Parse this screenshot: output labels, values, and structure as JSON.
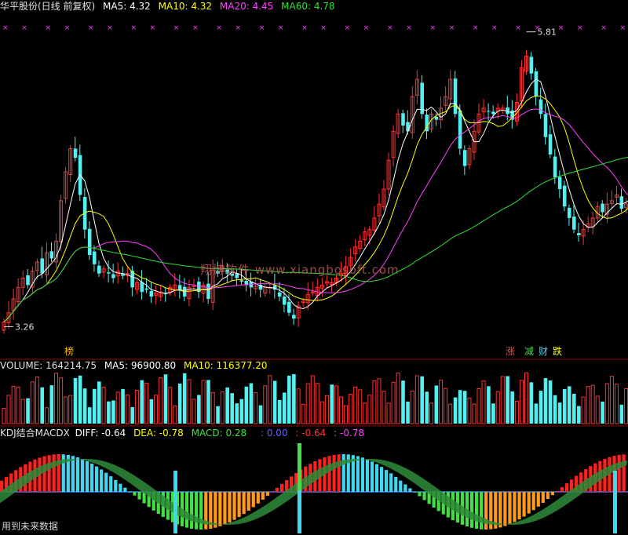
{
  "header": {
    "title": "华平股份(日线 前复权)",
    "ma5_label": "MA5: 4.32",
    "ma10_label": "MA10: 4.32",
    "ma20_label": "MA20: 4.45",
    "ma60_label": "MA60: 4.78"
  },
  "volume_header": {
    "volume_label": "VOLUME: 164214.75",
    "ma5_label": "MA5: 96900.80",
    "ma10_label": "MA10: 116377.20"
  },
  "indicator_header": {
    "name": "KDJ结合MACDX",
    "diff_label": "DIFF: -0.64",
    "dea_label": "DEA: -0.78",
    "macd_label": "MACD: 0.28",
    "v1_label": ": 0.00",
    "v2_label": ": -0.64",
    "v3_label": ": -0.78"
  },
  "flags": {
    "bang": "榜",
    "zhang": "涨",
    "jian": "减",
    "cai": "财",
    "die": "跌"
  },
  "footer_text": "用到未来数据",
  "watermark": "翔博软件 www.xiangbosoft.com",
  "colors": {
    "up": "#ff3030",
    "down": "#52f0f0",
    "ma5": "#ffffff",
    "ma10": "#ffff00",
    "ma20": "#ff40ff",
    "ma60": "#30e030",
    "kdj_pink": "#ff6eb4",
    "kdj_green": "#2e8b3a",
    "hist_red": "#ff2020",
    "hist_orange": "#ff9a1a",
    "hist_green": "#40e040",
    "hist_cyan": "#40d8f0",
    "axis_blue": "#3a7aff"
  },
  "chart_data": [
    {
      "type": "candlestick",
      "title": "华平股份(日线 前复权)",
      "series_names": [
        "MA5",
        "MA10",
        "MA20",
        "MA60"
      ],
      "annotations": [
        "5.81",
        "3.26"
      ],
      "high": 5.81,
      "low": 3.26,
      "ma": {
        "MA5": 4.32,
        "MA10": 4.32,
        "MA20": 4.45,
        "MA60": 4.78
      },
      "close": [
        3.3,
        3.38,
        3.5,
        3.6,
        3.68,
        3.62,
        3.74,
        3.82,
        3.72,
        3.9,
        3.85,
        4.0,
        4.35,
        4.6,
        4.8,
        4.72,
        4.4,
        4.1,
        3.88,
        3.8,
        3.72,
        3.76,
        3.72,
        3.68,
        3.74,
        3.7,
        3.72,
        3.6,
        3.64,
        3.56,
        3.58,
        3.52,
        3.55,
        3.56,
        3.54,
        3.6,
        3.62,
        3.58,
        3.52,
        3.6,
        3.62,
        3.56,
        3.62,
        3.5,
        3.75,
        3.72,
        3.78,
        3.72,
        3.7,
        3.68,
        3.65,
        3.62,
        3.6,
        3.61,
        3.58,
        3.6,
        3.6,
        3.58,
        3.52,
        3.45,
        3.38,
        3.33,
        3.44,
        3.48,
        3.54,
        3.56,
        3.6,
        3.62,
        3.65,
        3.64,
        3.68,
        3.72,
        3.78,
        3.86,
        3.95,
        4.0,
        4.08,
        4.1,
        4.2,
        4.32,
        4.45,
        4.7,
        4.95,
        5.1,
        5.0,
        4.95,
        5.25,
        5.4,
        5.1,
        4.95,
        5.1,
        5.05,
        5.15,
        5.25,
        5.4,
        5.1,
        4.8,
        4.65,
        4.8,
        4.95,
        5.1,
        5.15,
        5.12,
        5.1,
        5.15,
        5.15,
        5.1,
        5.05,
        5.2,
        5.5,
        5.6,
        5.45,
        5.25,
        5.1,
        4.9,
        4.75,
        4.55,
        4.45,
        4.3,
        4.2,
        4.1,
        4.05,
        4.1,
        4.15,
        4.2,
        4.3,
        4.25,
        4.32,
        4.35,
        4.4,
        4.28,
        4.32,
        4.5
      ],
      "volume_current": 164214.75,
      "volume_ma5": 96900.8,
      "volume_ma10": 116377.2
    },
    {
      "type": "bar",
      "title": "KDJ结合MACDX",
      "series_names": [
        "DIFF",
        "DEA",
        "MACD"
      ],
      "values": {
        "DIFF": -0.64,
        "DEA": -0.78,
        "MACD": 0.28
      }
    }
  ]
}
